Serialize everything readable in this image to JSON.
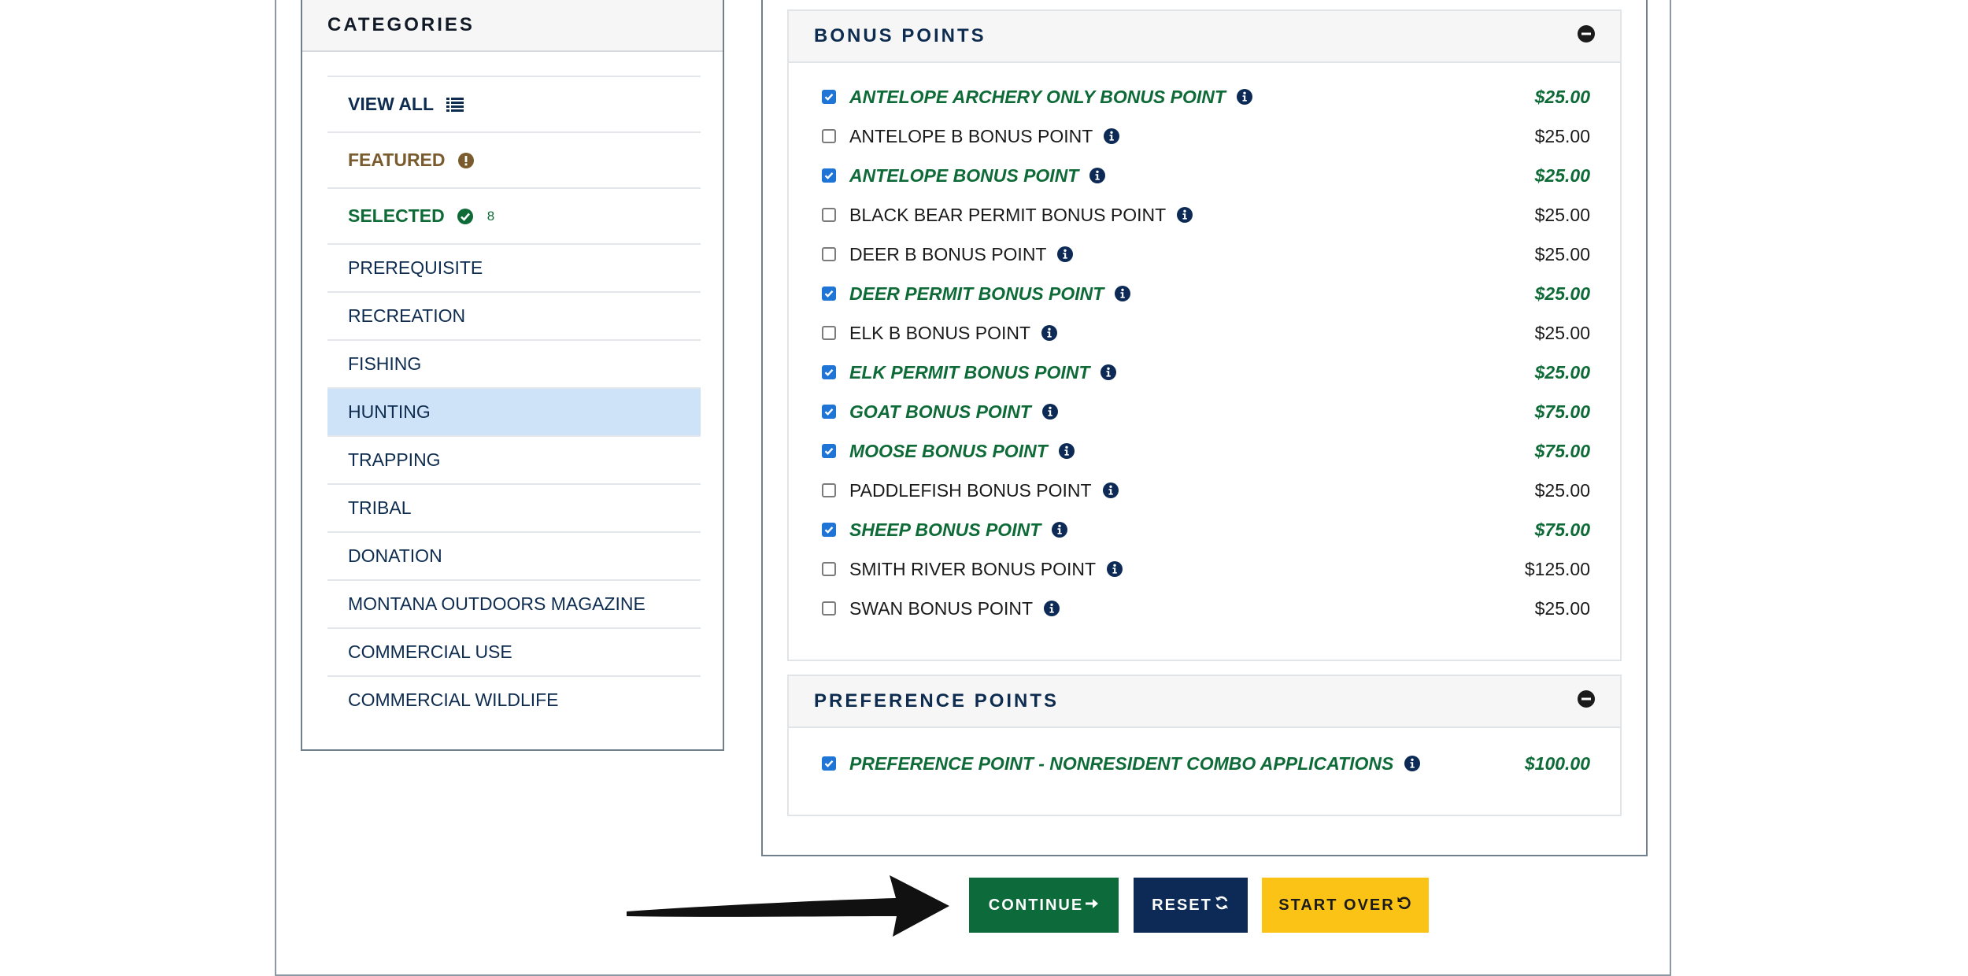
{
  "sidebar": {
    "title": "CATEGORIES",
    "view_all": "VIEW ALL",
    "featured": "FEATURED",
    "selected": "SELECTED",
    "selected_count": "8",
    "items": [
      "PREREQUISITE",
      "RECREATION",
      "FISHING",
      "HUNTING",
      "TRAPPING",
      "TRIBAL",
      "DONATION",
      "MONTANA OUTDOORS MAGAZINE",
      "COMMERCIAL USE",
      "COMMERCIAL WILDLIFE"
    ],
    "active_item": "HUNTING"
  },
  "bonus": {
    "title": "BONUS POINTS",
    "rows": [
      {
        "name": "ANTELOPE ARCHERY ONLY BONUS POINT",
        "price": "$25.00",
        "checked": true
      },
      {
        "name": "ANTELOPE B BONUS POINT",
        "price": "$25.00",
        "checked": false
      },
      {
        "name": "ANTELOPE BONUS POINT",
        "price": "$25.00",
        "checked": true
      },
      {
        "name": "BLACK BEAR PERMIT BONUS POINT",
        "price": "$25.00",
        "checked": false
      },
      {
        "name": "DEER B BONUS POINT",
        "price": "$25.00",
        "checked": false
      },
      {
        "name": "DEER PERMIT BONUS POINT",
        "price": "$25.00",
        "checked": true
      },
      {
        "name": "ELK B BONUS POINT",
        "price": "$25.00",
        "checked": false
      },
      {
        "name": "ELK PERMIT BONUS POINT",
        "price": "$25.00",
        "checked": true
      },
      {
        "name": "GOAT BONUS POINT",
        "price": "$75.00",
        "checked": true
      },
      {
        "name": "MOOSE BONUS POINT",
        "price": "$75.00",
        "checked": true
      },
      {
        "name": "PADDLEFISH BONUS POINT",
        "price": "$25.00",
        "checked": false
      },
      {
        "name": "SHEEP BONUS POINT",
        "price": "$75.00",
        "checked": true
      },
      {
        "name": "SMITH RIVER BONUS POINT",
        "price": "$125.00",
        "checked": false
      },
      {
        "name": "SWAN BONUS POINT",
        "price": "$25.00",
        "checked": false
      }
    ]
  },
  "preference": {
    "title": "PREFERENCE POINTS",
    "rows": [
      {
        "name": "PREFERENCE POINT - NONRESIDENT COMBO APPLICATIONS",
        "price": "$100.00",
        "checked": true
      }
    ]
  },
  "buttons": {
    "continue": "CONTINUE",
    "reset": "RESET",
    "start_over": "START OVER"
  },
  "colors": {
    "selected_green": "#0e6b37",
    "navy": "#0c2a55",
    "yellow": "#fbc316",
    "active_bg": "#cfe3f8"
  }
}
